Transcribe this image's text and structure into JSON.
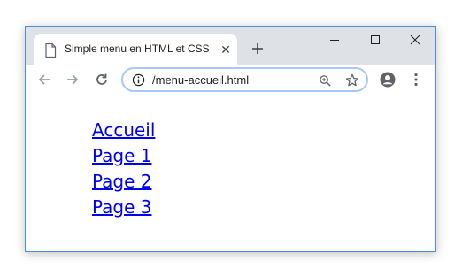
{
  "tab": {
    "title": "Simple menu en HTML et CSS",
    "close_glyph": "✕"
  },
  "address_bar": {
    "url": "/menu-accueil.html"
  },
  "icons": {
    "page": "document-icon",
    "close": "close-icon",
    "new_tab": "plus-icon",
    "minimize": "minimize-icon",
    "maximize": "maximize-icon",
    "window_close": "close-window-icon",
    "back": "back-arrow-icon",
    "forward": "forward-arrow-icon",
    "reload": "reload-icon",
    "site_info": "info-icon",
    "zoom": "zoom-icon",
    "bookmark": "star-icon",
    "profile": "account-icon",
    "menu": "kebab-menu-icon"
  },
  "colors": {
    "link": "#0000ee",
    "titlebar": "#dee1e6",
    "focus_ring": "#a8c7fa",
    "window_border": "#4a90d9"
  },
  "menu": {
    "items": [
      {
        "label": "Accueil"
      },
      {
        "label": "Page 1"
      },
      {
        "label": "Page 2"
      },
      {
        "label": "Page 3"
      }
    ]
  }
}
